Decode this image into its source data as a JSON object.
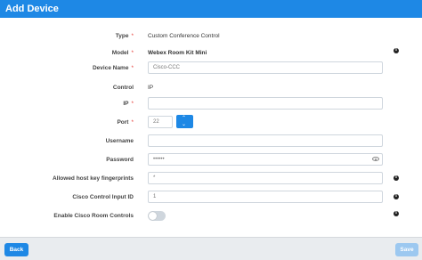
{
  "dialog": {
    "title": "Add Device"
  },
  "form": {
    "type": {
      "label": "Type",
      "required": "*",
      "value": "Custom Conference Control"
    },
    "model": {
      "label": "Model",
      "required": "*",
      "value": "Webex Room Kit Mini"
    },
    "device_name": {
      "label": "Device Name",
      "required": "*",
      "value": "Cisco-CCC"
    },
    "control": {
      "label": "Control",
      "value": "IP"
    },
    "ip": {
      "label": "IP",
      "required": "*",
      "value": ""
    },
    "port": {
      "label": "Port",
      "required": "*",
      "value": "22"
    },
    "username": {
      "label": "Username",
      "value": ""
    },
    "password": {
      "label": "Password",
      "value": "••••••"
    },
    "fingerprints": {
      "label": "Allowed host key fingerprints",
      "value": "*"
    },
    "input_id": {
      "label": "Cisco Control Input ID",
      "value": "1"
    },
    "room_controls": {
      "label": "Enable Cisco Room Controls",
      "enabled": false
    }
  },
  "stepper": {
    "up": "⌃",
    "down": "⌄"
  },
  "info_icon": "i",
  "footer": {
    "back_label": "Back",
    "save_label": "Save"
  },
  "colors": {
    "accent": "#1e88e5",
    "save_disabled": "#9cc8f0",
    "required": "#e53935"
  }
}
